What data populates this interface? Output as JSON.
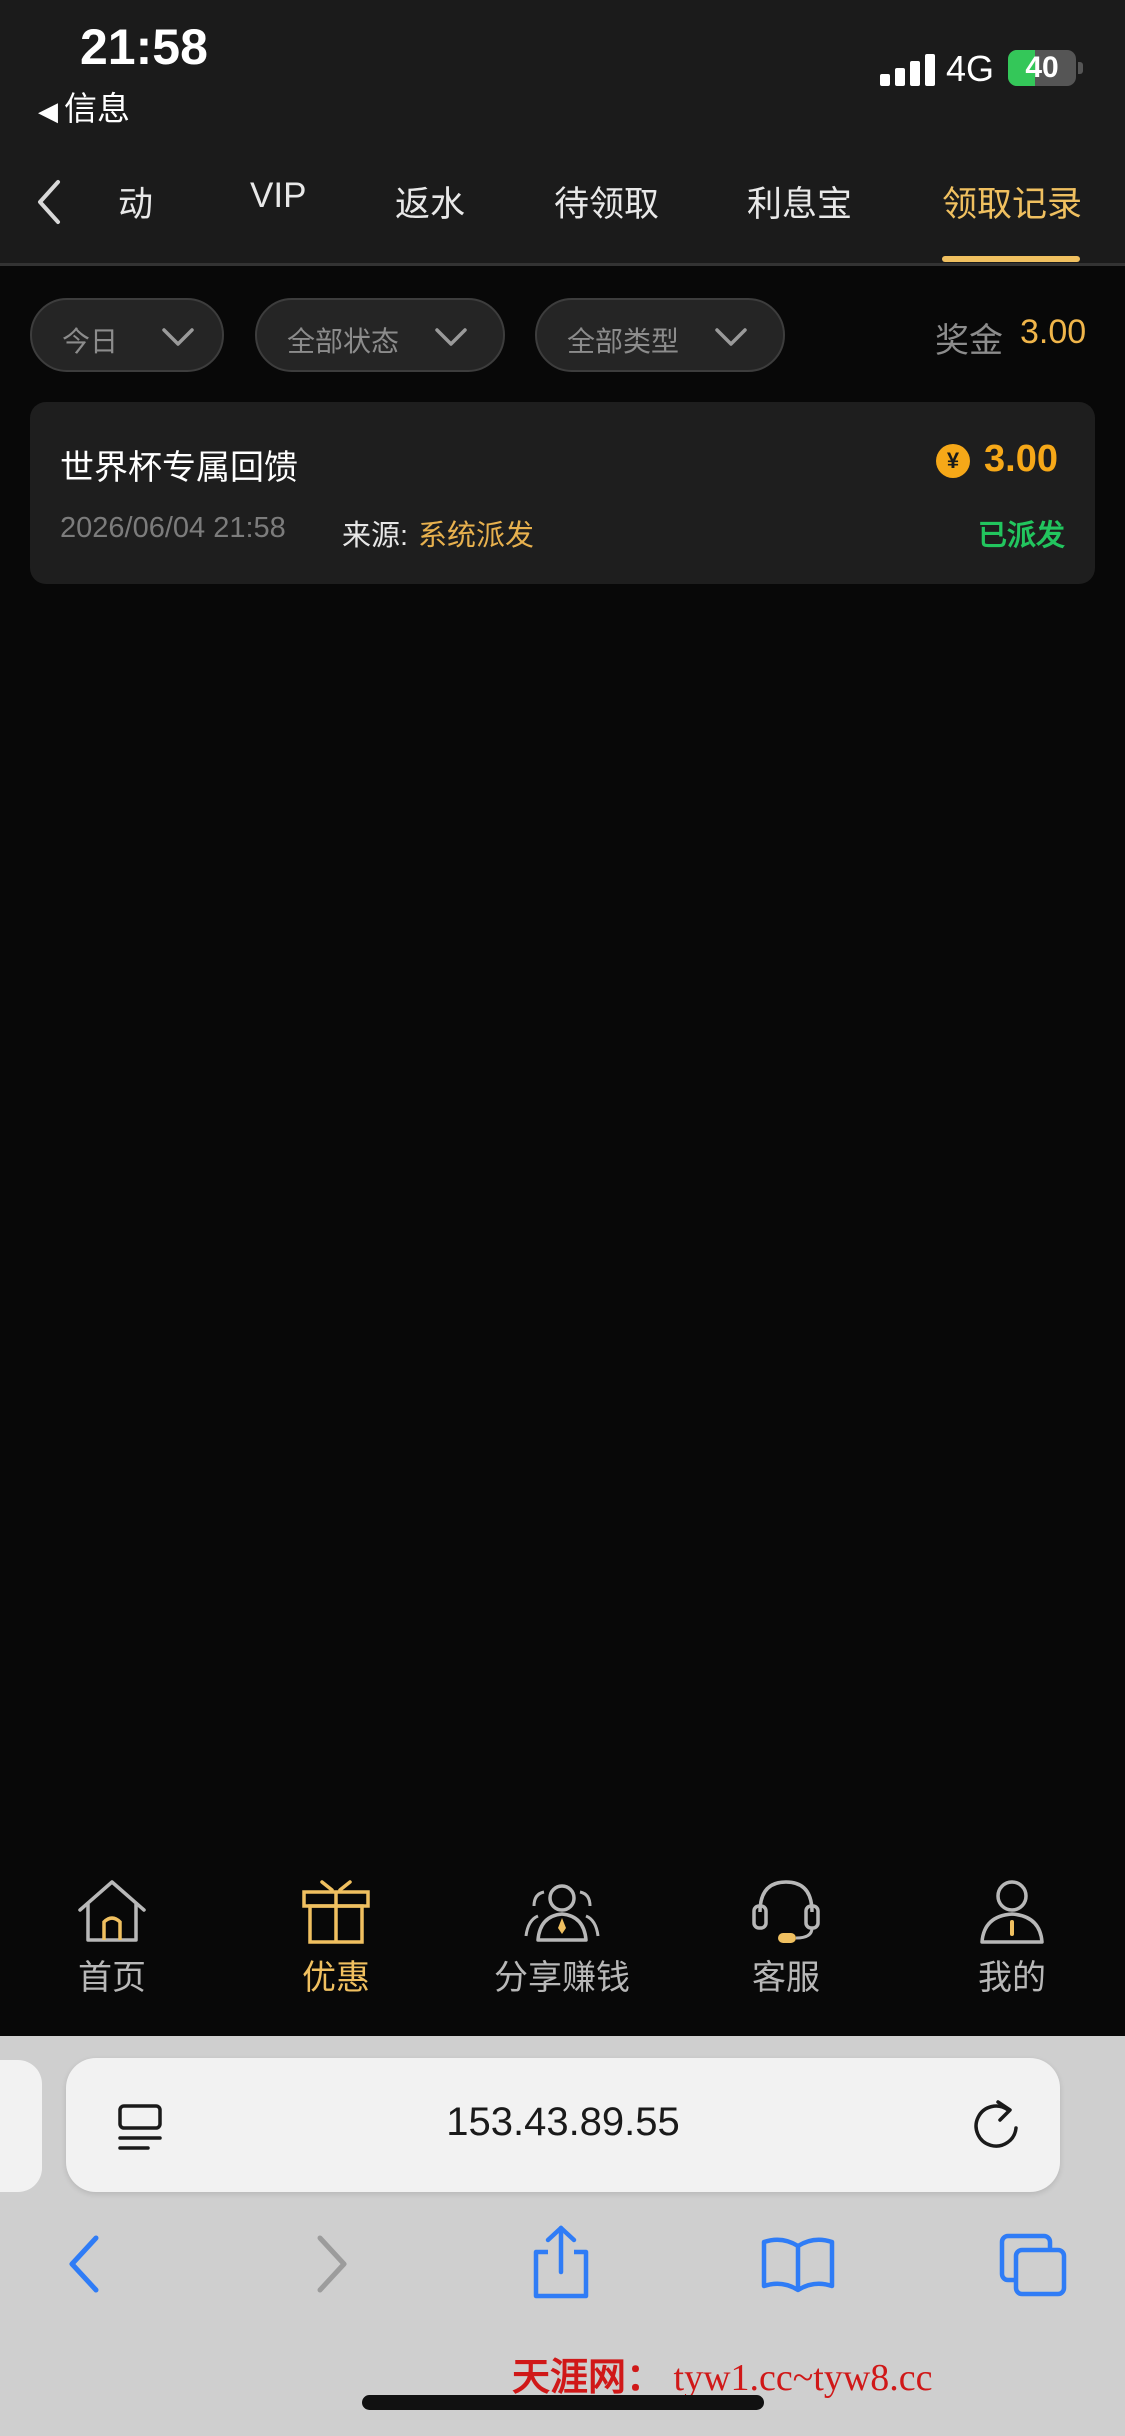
{
  "status_bar": {
    "time": "21:58",
    "back_label": "信息",
    "network": "4G",
    "battery": "40",
    "battery_level_percent": 40,
    "battery_color": "#34c759"
  },
  "tabs": {
    "items": [
      {
        "label": "活动",
        "visible_text": "动"
      },
      {
        "label": "VIP"
      },
      {
        "label": "返水"
      },
      {
        "label": "待领取"
      },
      {
        "label": "利息宝"
      },
      {
        "label": "领取记录"
      }
    ],
    "active_index": 5,
    "accent_color": "#f0c060"
  },
  "filters": {
    "date": "今日",
    "status": "全部状态",
    "type": "全部类型",
    "bonus_label": "奖金",
    "bonus_total": "3.00"
  },
  "records": [
    {
      "title": "世界杯专属回馈",
      "coin_symbol": "¥",
      "amount": "3.00",
      "datetime": "2026/06/04 21:58",
      "source_label": "来源:",
      "source": "系统派发",
      "status": "已派发",
      "status_color": "#22c55e"
    }
  ],
  "bottom_nav": {
    "items": [
      {
        "label": "首页",
        "icon": "home-icon"
      },
      {
        "label": "优惠",
        "icon": "gift-icon"
      },
      {
        "label": "分享赚钱",
        "icon": "share-earn-icon"
      },
      {
        "label": "客服",
        "icon": "headset-icon"
      },
      {
        "label": "我的",
        "icon": "user-icon"
      }
    ],
    "active_index": 1
  },
  "browser": {
    "url": "153.43.89.55"
  },
  "watermark": {
    "brand": "天涯网：",
    "domains": "tyw1.cc~tyw8.cc"
  }
}
